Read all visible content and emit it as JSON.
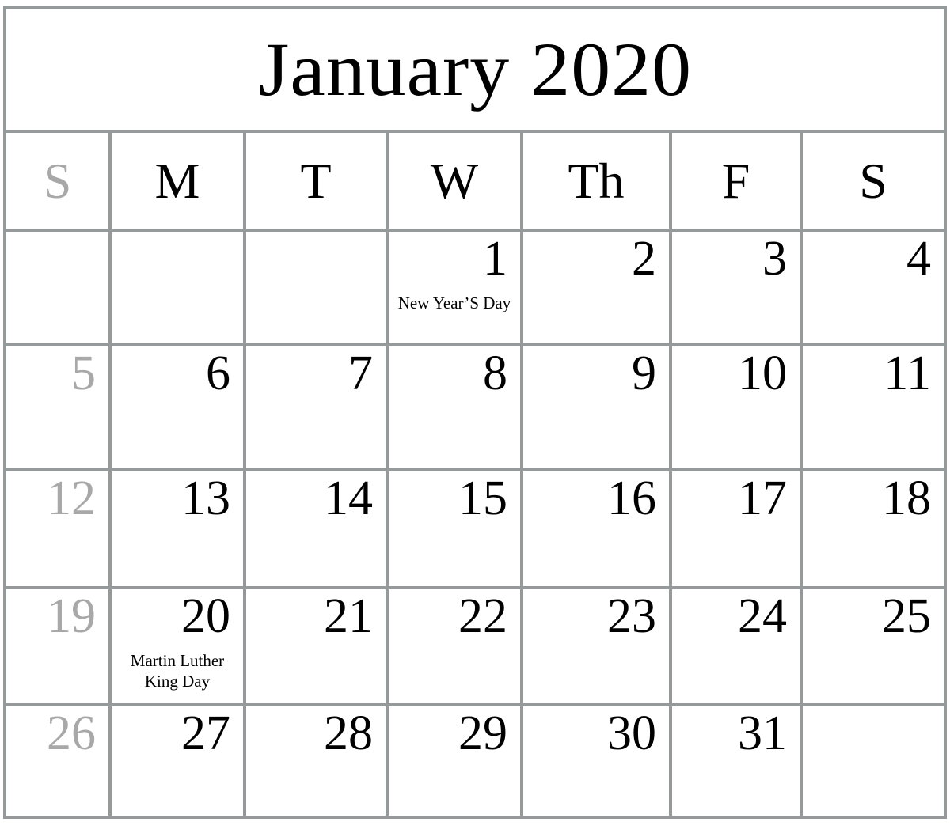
{
  "calendar": {
    "title": "January 2020",
    "month": "January",
    "year": "2020",
    "colors": {
      "grid_line": "#959999",
      "background": "#ffffff",
      "text": "#000000",
      "muted_text": "#a8a8a8"
    },
    "weekdays": [
      {
        "label": "S",
        "name": "sunday",
        "muted": true
      },
      {
        "label": "M",
        "name": "monday",
        "muted": false
      },
      {
        "label": "T",
        "name": "tuesday",
        "muted": false
      },
      {
        "label": "W",
        "name": "wednesday",
        "muted": false
      },
      {
        "label": "Th",
        "name": "thursday",
        "muted": false
      },
      {
        "label": "F",
        "name": "friday",
        "muted": false
      },
      {
        "label": "S",
        "name": "saturday",
        "muted": false
      }
    ],
    "weeks": [
      [
        {
          "day": "",
          "event": ""
        },
        {
          "day": "",
          "event": ""
        },
        {
          "day": "",
          "event": ""
        },
        {
          "day": "1",
          "event": "New Year’S Day"
        },
        {
          "day": "2",
          "event": ""
        },
        {
          "day": "3",
          "event": ""
        },
        {
          "day": "4",
          "event": ""
        }
      ],
      [
        {
          "day": "5",
          "event": ""
        },
        {
          "day": "6",
          "event": ""
        },
        {
          "day": "7",
          "event": ""
        },
        {
          "day": "8",
          "event": ""
        },
        {
          "day": "9",
          "event": ""
        },
        {
          "day": "10",
          "event": ""
        },
        {
          "day": "11",
          "event": ""
        }
      ],
      [
        {
          "day": "12",
          "event": ""
        },
        {
          "day": "13",
          "event": ""
        },
        {
          "day": "14",
          "event": ""
        },
        {
          "day": "15",
          "event": ""
        },
        {
          "day": "16",
          "event": ""
        },
        {
          "day": "17",
          "event": ""
        },
        {
          "day": "18",
          "event": ""
        }
      ],
      [
        {
          "day": "19",
          "event": ""
        },
        {
          "day": "20",
          "event": "Martin Luther King Day"
        },
        {
          "day": "21",
          "event": ""
        },
        {
          "day": "22",
          "event": ""
        },
        {
          "day": "23",
          "event": ""
        },
        {
          "day": "24",
          "event": ""
        },
        {
          "day": "25",
          "event": ""
        }
      ],
      [
        {
          "day": "26",
          "event": ""
        },
        {
          "day": "27",
          "event": ""
        },
        {
          "day": "28",
          "event": ""
        },
        {
          "day": "29",
          "event": ""
        },
        {
          "day": "30",
          "event": ""
        },
        {
          "day": "31",
          "event": ""
        },
        {
          "day": "",
          "event": ""
        }
      ]
    ]
  }
}
